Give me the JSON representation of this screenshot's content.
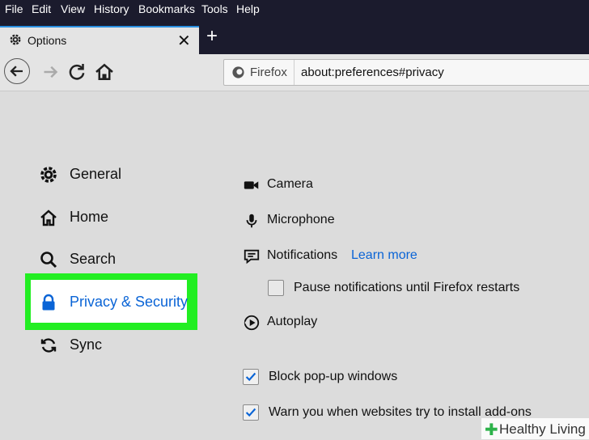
{
  "menubar": {
    "items": [
      "File",
      "Edit",
      "View",
      "History",
      "Bookmarks",
      "Tools",
      "Help"
    ]
  },
  "tab": {
    "title": "Options",
    "close": "✕",
    "new_tab": "+"
  },
  "navbar": {
    "identity_label": "Firefox",
    "url": "about:preferences#privacy"
  },
  "sidebar": {
    "items": [
      {
        "label": "General",
        "icon": "gear-icon"
      },
      {
        "label": "Home",
        "icon": "home-icon"
      },
      {
        "label": "Search",
        "icon": "search-icon"
      },
      {
        "label": "Privacy & Security",
        "icon": "lock-icon",
        "selected": true
      },
      {
        "label": "Sync",
        "icon": "sync-icon"
      }
    ]
  },
  "permissions": {
    "items": [
      {
        "label": "Camera",
        "icon": "camera-icon"
      },
      {
        "label": "Microphone",
        "icon": "microphone-icon"
      },
      {
        "label": "Notifications",
        "icon": "notifications-icon"
      },
      {
        "label": "Autoplay",
        "icon": "autoplay-icon"
      }
    ],
    "learn_more": "Learn more",
    "pause_notifications": {
      "label": "Pause notifications until Firefox restarts",
      "checked": false
    }
  },
  "options": {
    "block_popups": {
      "label": "Block pop-up windows",
      "checked": true
    },
    "warn_addons": {
      "label": "Warn you when websites try to install add-ons",
      "checked": true
    }
  },
  "watermark": {
    "text": "Healthy Living"
  },
  "colors": {
    "highlight": "#22ee22",
    "accent": "#0a64d6",
    "titlebar": "#1b1b2d"
  }
}
